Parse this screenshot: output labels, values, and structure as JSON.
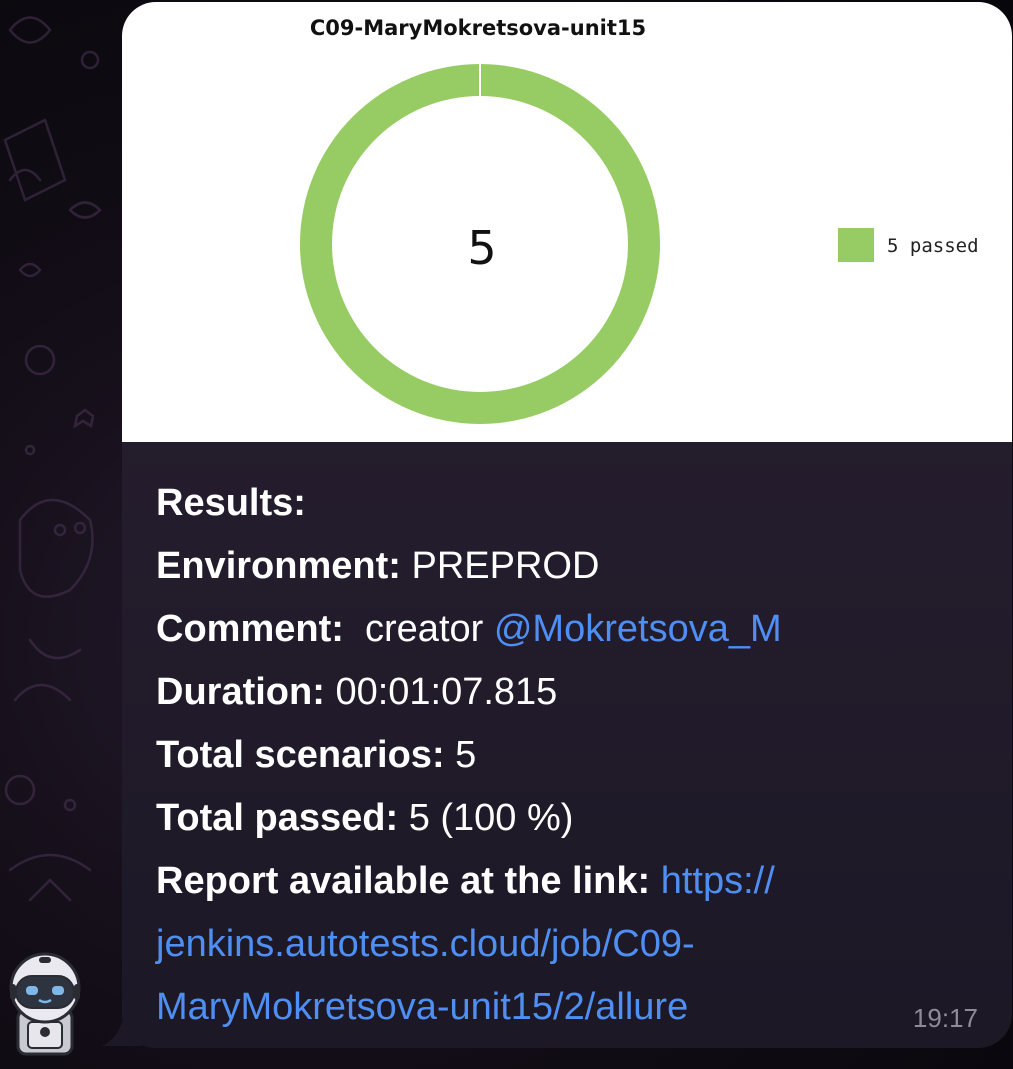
{
  "chart_data": {
    "type": "pie",
    "title": "C09-MaryMokretsova-unit15",
    "center_label": "5",
    "categories": [
      "5 passed"
    ],
    "values": [
      5
    ],
    "colors": [
      "#97cc64"
    ],
    "legend": "right"
  },
  "message": {
    "results_label": "Results:",
    "environment_label": "Environment:",
    "environment_value": "PREPROD",
    "comment_label": "Comment:",
    "comment_value": "creator",
    "comment_mention": "@Mokretsova_M",
    "duration_label": "Duration:",
    "duration_value": "00:01:07.815",
    "total_scenarios_label": "Total scenarios:",
    "total_scenarios_value": "5",
    "total_passed_label": "Total passed:",
    "total_passed_value": "5 (100 %)",
    "report_label": "Report available at the link:",
    "report_link": "https://jenkins.autotests.cloud/job/C09-MaryMokretsova-unit15/2/allure",
    "time": "19:17"
  },
  "colors": {
    "link": "#4f8ef2",
    "passed": "#97cc64"
  }
}
